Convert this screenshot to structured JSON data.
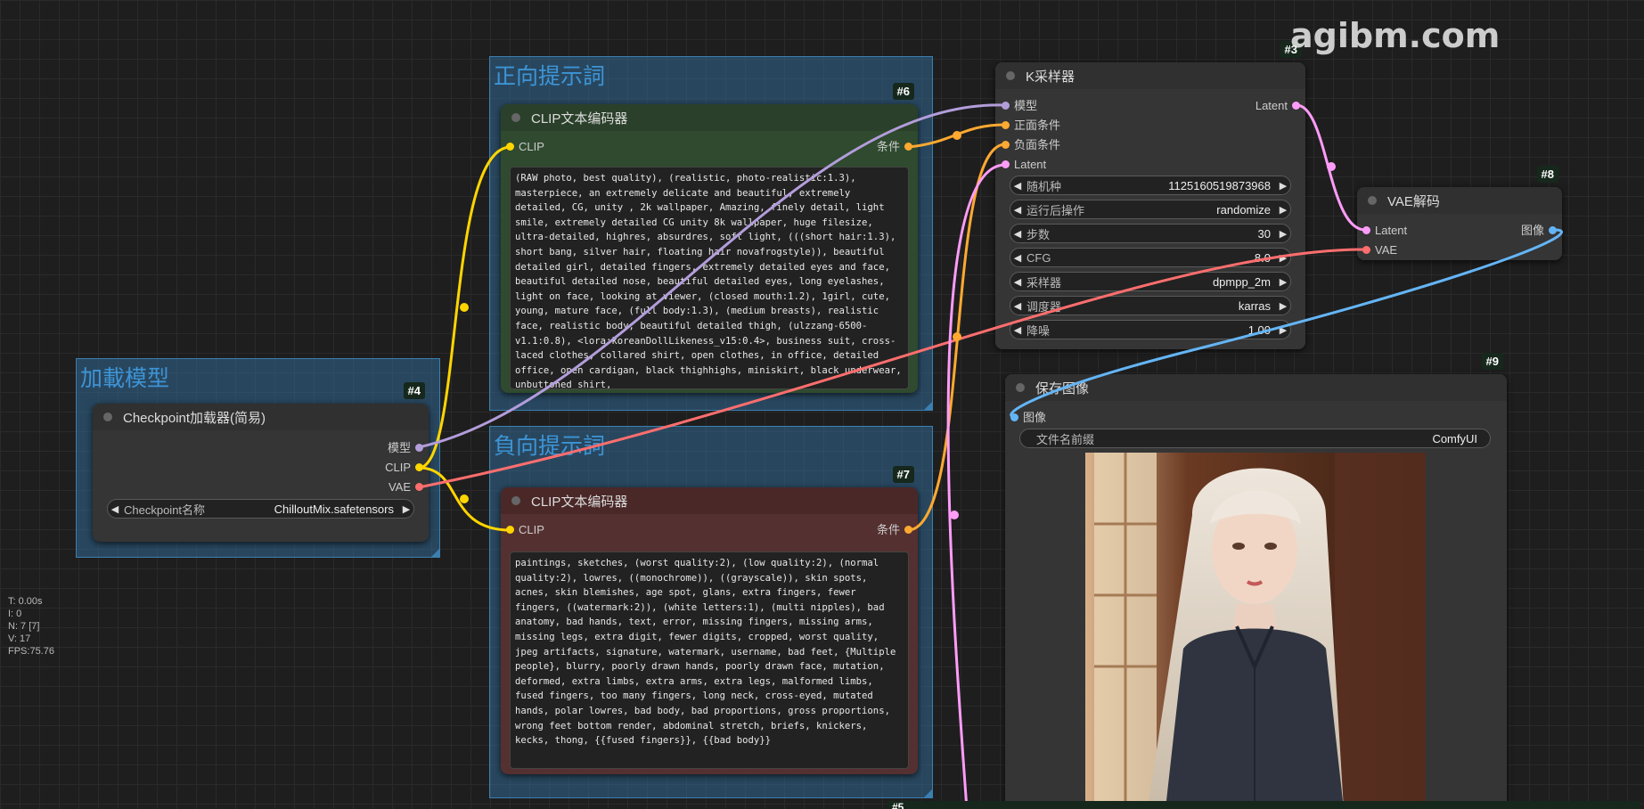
{
  "watermark": "agibm.com",
  "stats": {
    "t": "T: 0.00s",
    "i": "I: 0",
    "n": "N: 7 [7]",
    "v": "V: 17",
    "fps": "FPS:75.76"
  },
  "groups": {
    "positive": "正向提示詞",
    "negative": "負向提示詞",
    "load": "加載模型"
  },
  "colors": {
    "clip": "#ffd500",
    "model": "#b39ddb",
    "vae": "#ff6e6e",
    "cond": "#ffa931",
    "latent": "#ff9cf9",
    "image": "#64b5f6",
    "positive_node": "#2d4a2d",
    "negative_node": "#5a2a2a"
  },
  "nodes": {
    "clip_pos": {
      "badge": "#6",
      "title": "CLIP文本编码器",
      "in": "CLIP",
      "out": "条件",
      "text": "(RAW photo, best quality), (realistic, photo-realistic:1.3), masterpiece, an extremely delicate and beautiful, extremely detailed, CG, unity , 2k wallpaper, Amazing, finely detail, light smile, extremely detailed CG unity 8k wallpaper, huge filesize, ultra-detailed, highres, absurdres, soft light, (((short hair:1.3), short bang, silver hair, floating hair novafrogstyle)), beautiful detailed girl, detailed fingers, extremely detailed eyes and face, beautiful detailed nose, beautiful detailed eyes, long eyelashes, light on face, looking at viewer, (closed mouth:1.2), 1girl, cute, young, mature face, (full body:1.3), (medium breasts), realistic face, realistic body, beautiful detailed thigh, (ulzzang-6500-v1.1:0.8), <lora:koreanDollLikeness_v15:0.4>, business suit, cross-laced clothes, collared shirt, open clothes, in office, detailed office, open cardigan, black thighhighs, miniskirt, black underwear, unbuttoned shirt,"
    },
    "clip_neg": {
      "badge": "#7",
      "title": "CLIP文本编码器",
      "in": "CLIP",
      "out": "条件",
      "text": "paintings, sketches, (worst quality:2), (low quality:2), (normal quality:2), lowres, ((monochrome)), ((grayscale)), skin spots, acnes, skin blemishes, age spot, glans, extra fingers, fewer fingers, ((watermark:2)), (white letters:1), (multi nipples), bad anatomy, bad hands, text, error, missing fingers, missing arms, missing legs, extra digit, fewer digits, cropped, worst quality, jpeg artifacts, signature, watermark, username, bad feet, {Multiple people}, blurry, poorly drawn hands, poorly drawn face, mutation, deformed, extra limbs, extra arms, extra legs, malformed limbs, fused fingers, too many fingers, long neck, cross-eyed, mutated hands, polar lowres, bad body, bad proportions, gross proportions, wrong feet bottom render, abdominal stretch, briefs, knickers, kecks, thong, {{fused fingers}}, {{bad body}}"
    },
    "checkpoint": {
      "badge": "#4",
      "title": "Checkpoint加载器(简易)",
      "out_model": "模型",
      "out_clip": "CLIP",
      "out_vae": "VAE",
      "widget_name": "Checkpoint名称",
      "widget_value": "ChilloutMix.safetensors"
    },
    "ksampler": {
      "badge": "#3",
      "title": "K采样器",
      "in_model": "模型",
      "in_pos": "正面条件",
      "in_neg": "负面条件",
      "in_latent": "Latent",
      "out_latent": "Latent",
      "widgets": [
        {
          "name": "随机种",
          "value": "1125160519873968"
        },
        {
          "name": "运行后操作",
          "value": "randomize"
        },
        {
          "name": "步数",
          "value": "30"
        },
        {
          "name": "CFG",
          "value": "8.0"
        },
        {
          "name": "采样器",
          "value": "dpmpp_2m"
        },
        {
          "name": "调度器",
          "value": "karras"
        },
        {
          "name": "降噪",
          "value": "1.00"
        }
      ]
    },
    "vae_decode": {
      "badge": "#8",
      "title": "VAE解码",
      "in_latent": "Latent",
      "in_vae": "VAE",
      "out_image": "图像"
    },
    "save_image": {
      "badge": "#9",
      "title": "保存图像",
      "in_image": "图像",
      "widget_name": "文件名前缀",
      "widget_value": "ComfyUI"
    },
    "bottom_badge": "#5"
  }
}
